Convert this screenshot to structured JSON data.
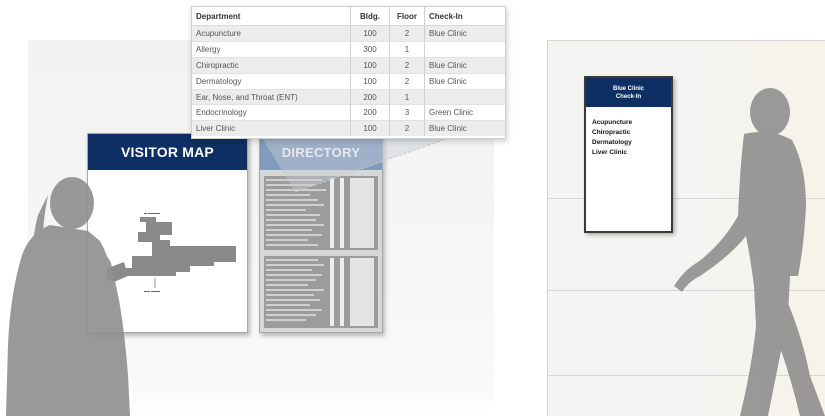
{
  "visitor_map": {
    "title": "VISITOR MAP"
  },
  "directory": {
    "title": "DIRECTORY",
    "columns": [
      "Department",
      "Bldg.",
      "Floor",
      "Check-In"
    ],
    "rows": [
      [
        "Acupuncture",
        "100",
        "2",
        "Blue Clinic"
      ],
      [
        "Allergy",
        "300",
        "1",
        ""
      ],
      [
        "Chiropractic",
        "100",
        "2",
        "Blue Clinic"
      ],
      [
        "Dermatology",
        "100",
        "2",
        "Blue Clinic"
      ],
      [
        "Ear, Nose, and Throat (ENT)",
        "200",
        "1",
        ""
      ],
      [
        "Endocrinology",
        "200",
        "3",
        "Green Clinic"
      ],
      [
        "Liver Clinic",
        "100",
        "2",
        "Blue Clinic"
      ]
    ]
  },
  "clinic_sign": {
    "title_line1": "Blue Clinic",
    "title_line2": "Check-In",
    "items": [
      "Acupuncture",
      "Chiropractic",
      "Dermatology",
      "Liver Clinic"
    ]
  },
  "colors": {
    "navy": "#0d2f64",
    "directory_header": "#7f9cbd",
    "silhouette": "#8f8f8f"
  }
}
